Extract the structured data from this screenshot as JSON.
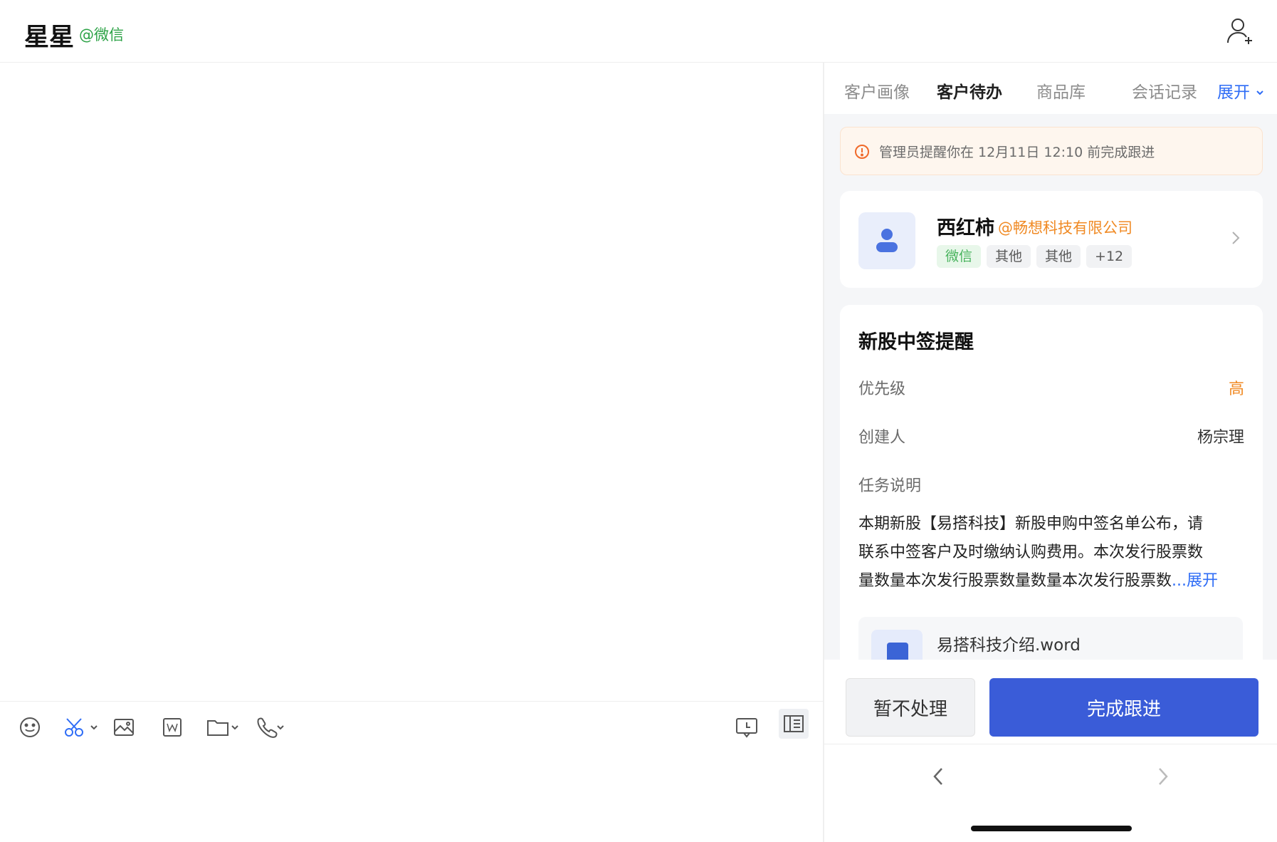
{
  "header": {
    "contact_name": "星星",
    "contact_source": "@微信",
    "add_contact_icon": "person-add-icon"
  },
  "toolbar": {
    "icons": [
      "emoji-icon",
      "screenshot-scissors-icon",
      "image-icon",
      "word-doc-icon",
      "folder-icon",
      "phone-icon",
      "quick-reply-icon",
      "sidebar-panel-icon"
    ],
    "accent": "#2f6df6"
  },
  "panel": {
    "tabs": [
      {
        "label": "客户画像",
        "active": false
      },
      {
        "label": "客户待办",
        "active": true
      },
      {
        "label": "商品库",
        "active": false
      },
      {
        "label": "会话记录",
        "active": false
      }
    ],
    "expand_label": "展开",
    "alert": {
      "text": "管理员提醒你在 12月11日 12:10 前完成跟进",
      "icon": "warning-circle-icon",
      "color": "#f06a2a"
    },
    "customer": {
      "name": "西红柿",
      "company": "@畅想科技有限公司",
      "tags": [
        "微信",
        "其他",
        "其他",
        "+12"
      ]
    },
    "task": {
      "title": "新股中签提醒",
      "priority_label": "优先级",
      "priority_value": "高",
      "creator_label": "创建人",
      "creator_value": "杨宗理",
      "desc_label": "任务说明",
      "desc_lines": [
        "本期新股【易搭科技】新股申购中签名单公布，请",
        "联系中签客户及时缴纳认购费用。本次发行股票数",
        "量数量本次发行股票数量数量本次发行股票数"
      ],
      "desc_more": "...展开",
      "attachment": "易搭科技介绍.word"
    },
    "actions": {
      "skip_label": "暂不处理",
      "done_label": "完成跟进",
      "done_color": "#3a5cd8"
    }
  }
}
